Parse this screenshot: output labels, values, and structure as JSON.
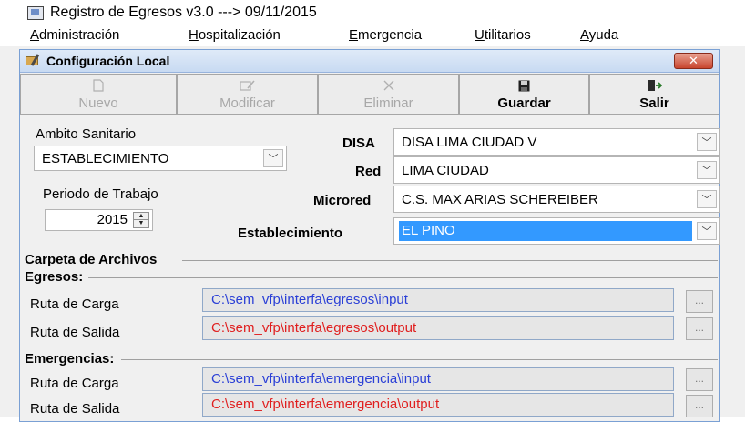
{
  "window": {
    "title": "Registro de Egresos v3.0  ---> 09/11/2015"
  },
  "menubar": [
    {
      "first": "A",
      "rest": "dministración"
    },
    {
      "first": "H",
      "rest": "ospitalización"
    },
    {
      "first": "E",
      "rest": "mergencia"
    },
    {
      "first": "U",
      "rest": "tilitarios"
    },
    {
      "first": "A",
      "rest": "yuda"
    }
  ],
  "dialog": {
    "title": "Configuración Local",
    "close": "✕"
  },
  "toolbar": {
    "nuevo": {
      "label": "Nuevo",
      "icon": "new-document-icon",
      "enabled": false
    },
    "modificar": {
      "label": "Modificar",
      "icon": "edit-icon",
      "enabled": false
    },
    "eliminar": {
      "label": "Eliminar",
      "icon": "delete-icon",
      "enabled": false
    },
    "guardar": {
      "label": "Guardar",
      "icon": "save-floppy-icon",
      "enabled": true
    },
    "salir": {
      "label": "Salir",
      "icon": "exit-door-icon",
      "enabled": true
    }
  },
  "form": {
    "ambito_label": "Ambito Sanitario",
    "ambito_value": "ESTABLECIMIENTO",
    "periodo_label": "Periodo de Trabajo",
    "periodo_value": "2015",
    "disa_label": "DISA",
    "disa_value": "DISA LIMA CIUDAD V",
    "red_label": "Red",
    "red_value": "LIMA CIUDAD",
    "microred_label": "Microred",
    "microred_value": "C.S. MAX ARIAS SCHEREIBER",
    "establecimiento_label": "Establecimiento",
    "establecimiento_value": "EL PINO"
  },
  "archivos": {
    "title": "Carpeta de Archivos",
    "browse_label": "...",
    "egresos": {
      "title": "Egresos:",
      "carga_label": "Ruta de Carga",
      "carga_path": "C:\\sem_vfp\\interfa\\egresos\\input",
      "salida_label": "Ruta de Salida",
      "salida_path": "C:\\sem_vfp\\interfa\\egresos\\output"
    },
    "emergencias": {
      "title": "Emergencias:",
      "carga_label": "Ruta de Carga",
      "carga_path": "C:\\sem_vfp\\interfa\\emergencia\\input",
      "salida_label": "Ruta de Salida",
      "salida_path": "C:\\sem_vfp\\interfa\\emergencia\\output"
    }
  },
  "colors": {
    "input_path": "#2a3fd6",
    "output_path": "#e01f1f",
    "selection": "#3399ff",
    "close_button": "#c8452e"
  }
}
